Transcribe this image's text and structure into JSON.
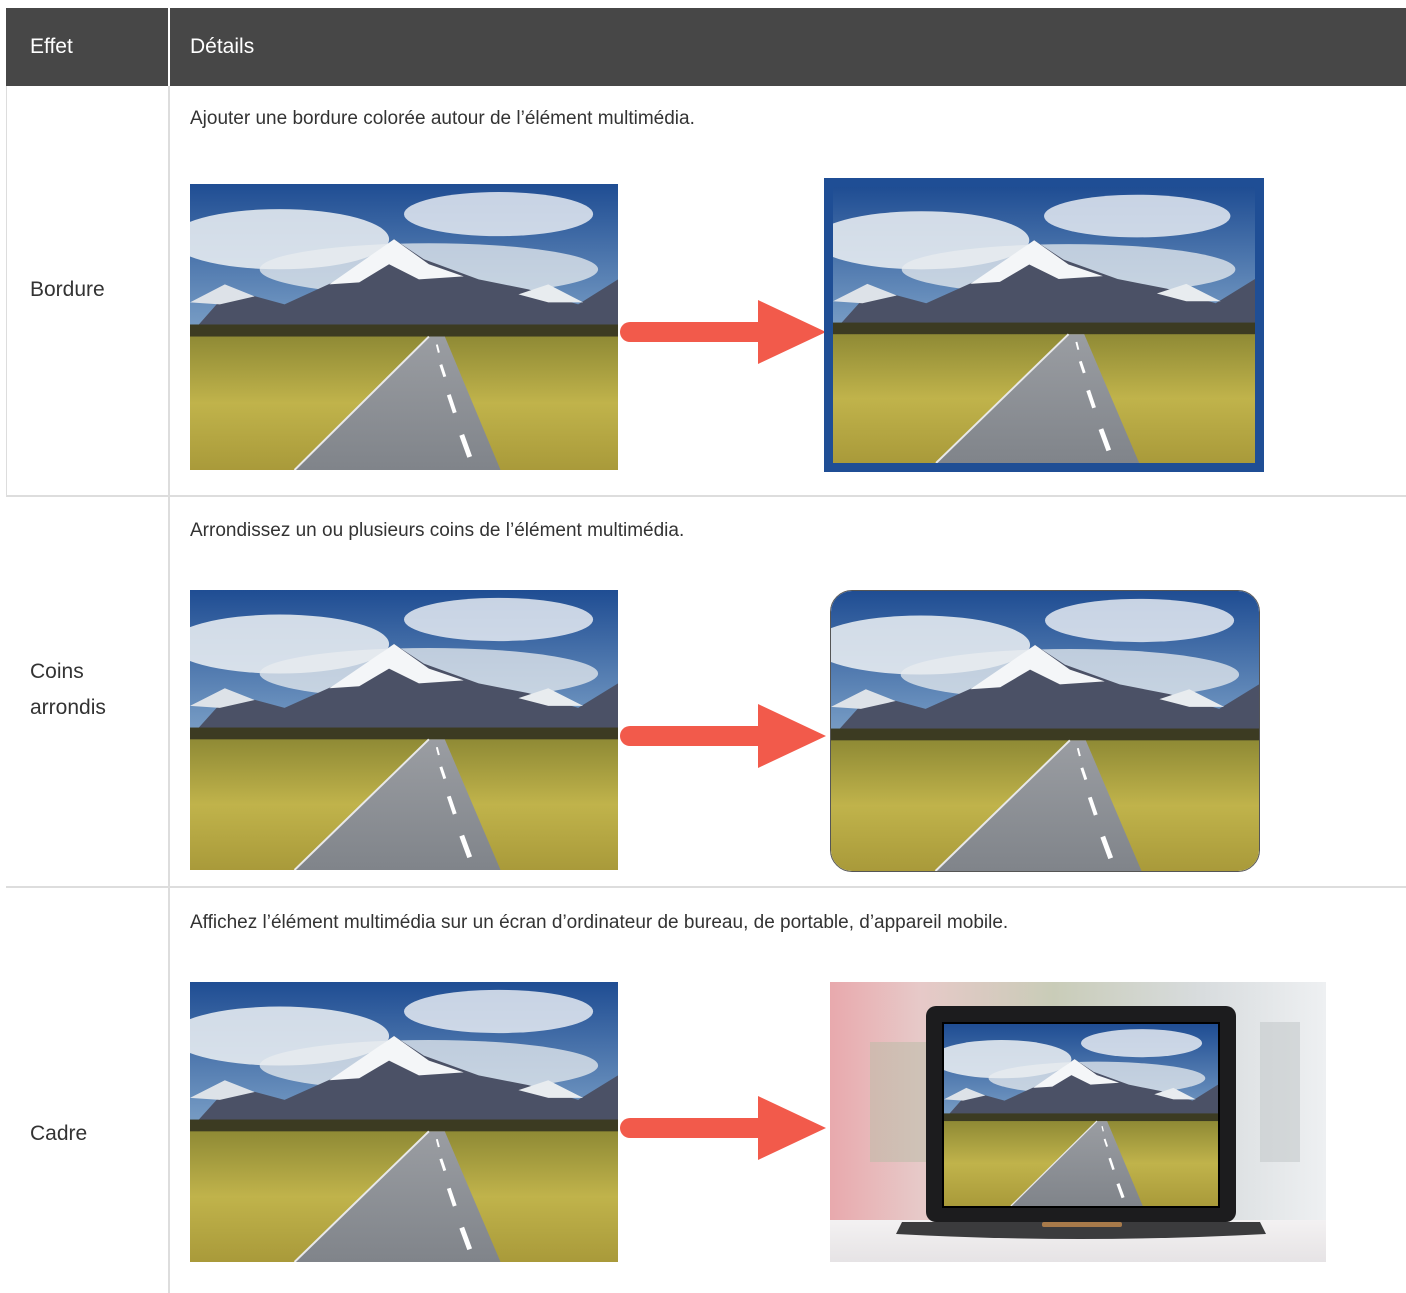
{
  "table": {
    "headers": {
      "effect": "Effet",
      "details": "Détails"
    },
    "rows": [
      {
        "effect": "Bordure",
        "description": "Ajouter une bordure colorée autour de l’élément multimédia.",
        "after_frame_color": "#1f4e95"
      },
      {
        "effect_line1": "Coins",
        "effect_line2": "arrondis",
        "description": "Arrondissez un ou plusieurs coins de l’élément multimédia."
      },
      {
        "effect": "Cadre",
        "description": "Affichez l’élément multimédia sur un écran d’ordinateur de bureau, de portable, d’appareil mobile."
      }
    ]
  },
  "colors": {
    "header_bg": "#474747",
    "arrow": "#f25a4b",
    "grid": "#dddddd"
  },
  "icons": {
    "arrow": "right-arrow-icon",
    "photo": "mountain-road-photo",
    "laptop": "laptop-frame-photo"
  }
}
